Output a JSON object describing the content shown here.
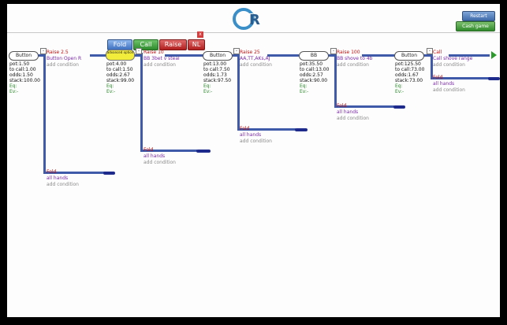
{
  "header": {
    "logo_text": "GR",
    "restart_label": "Restart",
    "cash_game_label": "Cash game"
  },
  "actions": {
    "fold": "Fold",
    "call": "Call",
    "raise": "Raise",
    "nl": "NL",
    "close": "x"
  },
  "nodes": [
    {
      "pill": "Button",
      "stats": [
        "pot:1.50",
        "to call:1.00",
        "odds:1.50",
        "stack:100.00"
      ],
      "eq": "Eq:",
      "ev": "Ev:-"
    },
    {
      "pill": "advanced option",
      "stats": [
        "pot:4.00",
        "to call:1.50",
        "odds:2.67",
        "stack:99.00"
      ],
      "eq": "Eq:",
      "ev": "Ev:-"
    },
    {
      "pill": "Button",
      "stats": [
        "pot:13.00",
        "to call:7.50",
        "odds:1.73",
        "stack:97.50"
      ],
      "eq": "Eq:",
      "ev": "Ev:-"
    },
    {
      "pill": "BB",
      "stats": [
        "pot:35.50",
        "to call:13.00",
        "odds:2.57",
        "stack:90.00"
      ],
      "eq": "Eq:",
      "ev": "Ev:-"
    },
    {
      "pill": "Button",
      "stats": [
        "pot:125.50",
        "to call:73.00",
        "odds:1.67",
        "stack:73.00"
      ],
      "eq": "Eq:",
      "ev": "Ev:-"
    }
  ],
  "branches": [
    {
      "action": "Raise 2.5",
      "range": "Button Open R",
      "cond": "add condition"
    },
    {
      "action": "Raise 10",
      "range": "BB 3bet v steal",
      "cond": "add condition"
    },
    {
      "action": "Raise 25",
      "range": "AA,TT,AKs,AJ",
      "cond": "add condition"
    },
    {
      "action": "Raise 100",
      "range": "BB shove to 4b",
      "cond": "add condition"
    },
    {
      "action": "Call",
      "range": "Call shove range",
      "cond": "add condition"
    }
  ],
  "folds": [
    {
      "action": "Fold",
      "range": "all hands",
      "cond": "add condition"
    },
    {
      "action": "Fold",
      "range": "all hands",
      "cond": "add condition"
    },
    {
      "action": "Fold",
      "range": "all hands",
      "cond": "add condition"
    },
    {
      "action": "Fold",
      "range": "all hands",
      "cond": "add condition"
    },
    {
      "action": "Fold",
      "range": "all hands",
      "cond": "add condition"
    }
  ],
  "colors": {
    "line": "#3e5aa8",
    "fold_bar": "#1e2a8c",
    "arrow": "#2b9b2b"
  }
}
